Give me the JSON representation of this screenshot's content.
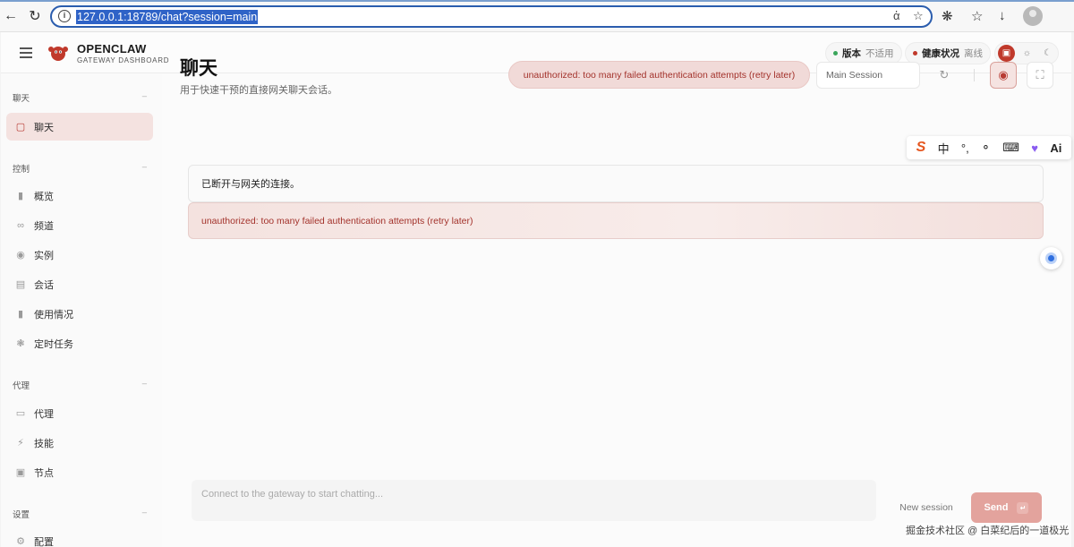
{
  "browser": {
    "url": "127.0.0.1:18789/chat?session=main"
  },
  "header": {
    "brand_title": "OPENCLAW",
    "brand_subtitle": "GATEWAY DASHBOARD",
    "version_label": "版本",
    "version_value": "不适用",
    "health_label": "健康状况",
    "health_value": "离线",
    "colors": {
      "version_dot": "#3aa55a",
      "health_dot": "#c0392b",
      "accent": "#c0392b"
    }
  },
  "sidebar": {
    "sections": [
      {
        "title": "聊天",
        "items": [
          {
            "label": "聊天",
            "icon": "message-square-icon",
            "active": true
          }
        ]
      },
      {
        "title": "控制",
        "items": [
          {
            "label": "概览",
            "icon": "bar-chart-icon"
          },
          {
            "label": "频道",
            "icon": "link-icon"
          },
          {
            "label": "实例",
            "icon": "radio-icon"
          },
          {
            "label": "会话",
            "icon": "file-text-icon"
          },
          {
            "label": "使用情况",
            "icon": "bar-chart-icon"
          },
          {
            "label": "定时任务",
            "icon": "loader-icon"
          }
        ]
      },
      {
        "title": "代理",
        "items": [
          {
            "label": "代理",
            "icon": "folder-icon"
          },
          {
            "label": "技能",
            "icon": "zap-icon"
          },
          {
            "label": "节点",
            "icon": "monitor-icon"
          }
        ]
      },
      {
        "title": "设置",
        "items": [
          {
            "label": "配置",
            "icon": "settings-icon"
          }
        ]
      }
    ]
  },
  "main": {
    "title": "聊天",
    "subtitle": "用于快速干预的直接网关聊天会话。",
    "error_banner": "unauthorized: too many failed authentication attempts (retry later)",
    "session_select": "Main Session"
  },
  "thread": {
    "info_message": "已断开与网关的连接。",
    "error_message": "unauthorized: too many failed authentication attempts (retry later)"
  },
  "composer": {
    "placeholder": "Connect to the gateway to start chatting...",
    "new_session": "New session",
    "send": "Send"
  },
  "ime": {
    "lang": "中",
    "ai": "Ai"
  },
  "watermark": "掘金技术社区 @ 白菜纪后的一道极光"
}
